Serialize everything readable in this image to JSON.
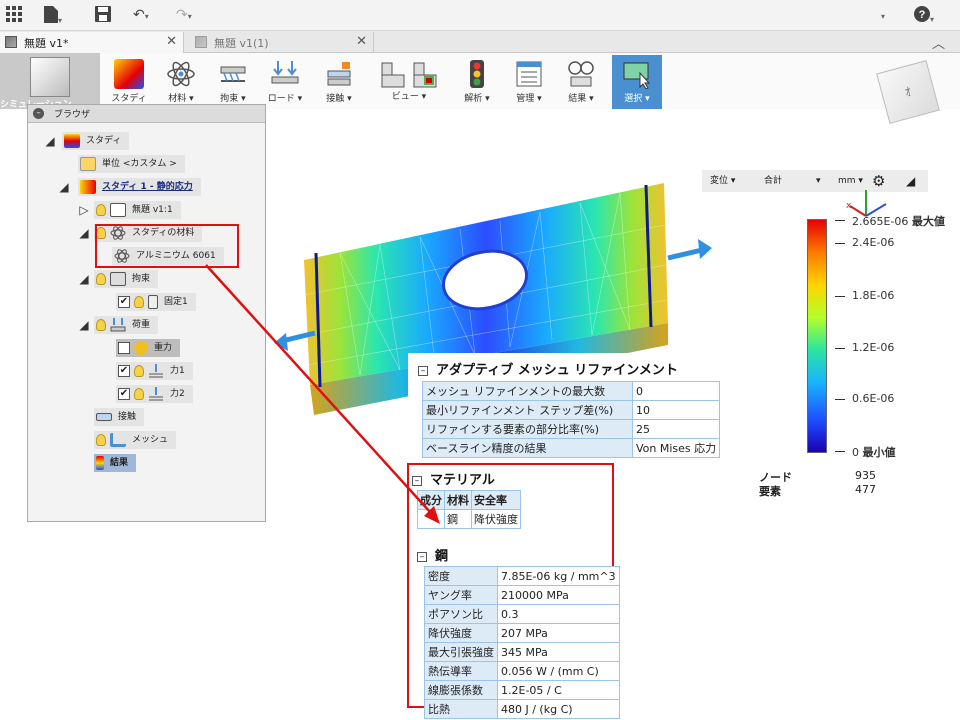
{
  "tabs": [
    {
      "label": "無題 v1*"
    },
    {
      "label": "無題 v1(1)"
    }
  ],
  "ribbon": {
    "simulation": "シミュレーション",
    "items": [
      {
        "label": "スタディ"
      },
      {
        "label": "材料 ▾"
      },
      {
        "label": "拘束 ▾"
      },
      {
        "label": "ロード ▾"
      },
      {
        "label": "接触 ▾"
      },
      {
        "label": "ビュー ▾"
      },
      {
        "label": "解析 ▾"
      },
      {
        "label": "管理 ▾"
      },
      {
        "label": "結果 ▾"
      },
      {
        "label": "選択 ▾"
      }
    ]
  },
  "viewcube_label": "ｵ",
  "browser": {
    "title": "ブラウザ",
    "nodes": {
      "study": "スタディ",
      "units": "単位 <カスタム >",
      "study1": "スタディ 1 - 静的応力",
      "untitled": "無題 v1:1",
      "study_materials": "スタディの材料",
      "aluminum": "アルミニウム 6061",
      "constraints": "拘束",
      "fixed1": "固定1",
      "loads": "荷重",
      "gravity": "重力",
      "force1": "力1",
      "force2": "力2",
      "contacts": "接触",
      "mesh": "メッシュ",
      "results": "結果"
    }
  },
  "legend": {
    "result_type": "変位",
    "component": "合計",
    "unit": "mm",
    "max_value": "2.665E-06",
    "max_label": "最大値",
    "min_value": "0",
    "min_label": "最小値",
    "ticks": [
      "2.4E-06",
      "1.8E-06",
      "1.2E-06",
      "0.6E-06"
    ],
    "nodes_label": "ノード",
    "nodes_value": "935",
    "elements_label": "要素",
    "elements_value": "477"
  },
  "adaptive": {
    "title": "アダプティブ メッシュ リファインメント",
    "rows": [
      {
        "k": "メッシュ リファインメントの最大数",
        "v": "0"
      },
      {
        "k": "最小リファインメント ステップ差(%)",
        "v": "10"
      },
      {
        "k": "リファインする要素の部分比率(%)",
        "v": "25"
      },
      {
        "k": "ベースライン精度の結果",
        "v": "Von Mises 応力"
      }
    ]
  },
  "material": {
    "title": "マテリアル",
    "headers": [
      "成分",
      "材料",
      "安全率"
    ],
    "row": [
      "",
      "鋼",
      "降伏強度"
    ],
    "steel_title": "鋼",
    "props": [
      {
        "k": "密度",
        "v": "7.85E-06 kg / mm^3"
      },
      {
        "k": "ヤング率",
        "v": "210000 MPa"
      },
      {
        "k": "ポアソン比",
        "v": "0.3"
      },
      {
        "k": "降伏強度",
        "v": "207 MPa"
      },
      {
        "k": "最大引張強度",
        "v": "345 MPa"
      },
      {
        "k": "熱伝導率",
        "v": "0.056 W / (mm C)"
      },
      {
        "k": "線膨張係数",
        "v": "1.2E-05 / C"
      },
      {
        "k": "比熱",
        "v": "480 J / (kg C)"
      }
    ]
  },
  "colors": {
    "highlight": "#e01010",
    "selection": "#4a8fcf",
    "table_fill": "#ddebf7"
  }
}
